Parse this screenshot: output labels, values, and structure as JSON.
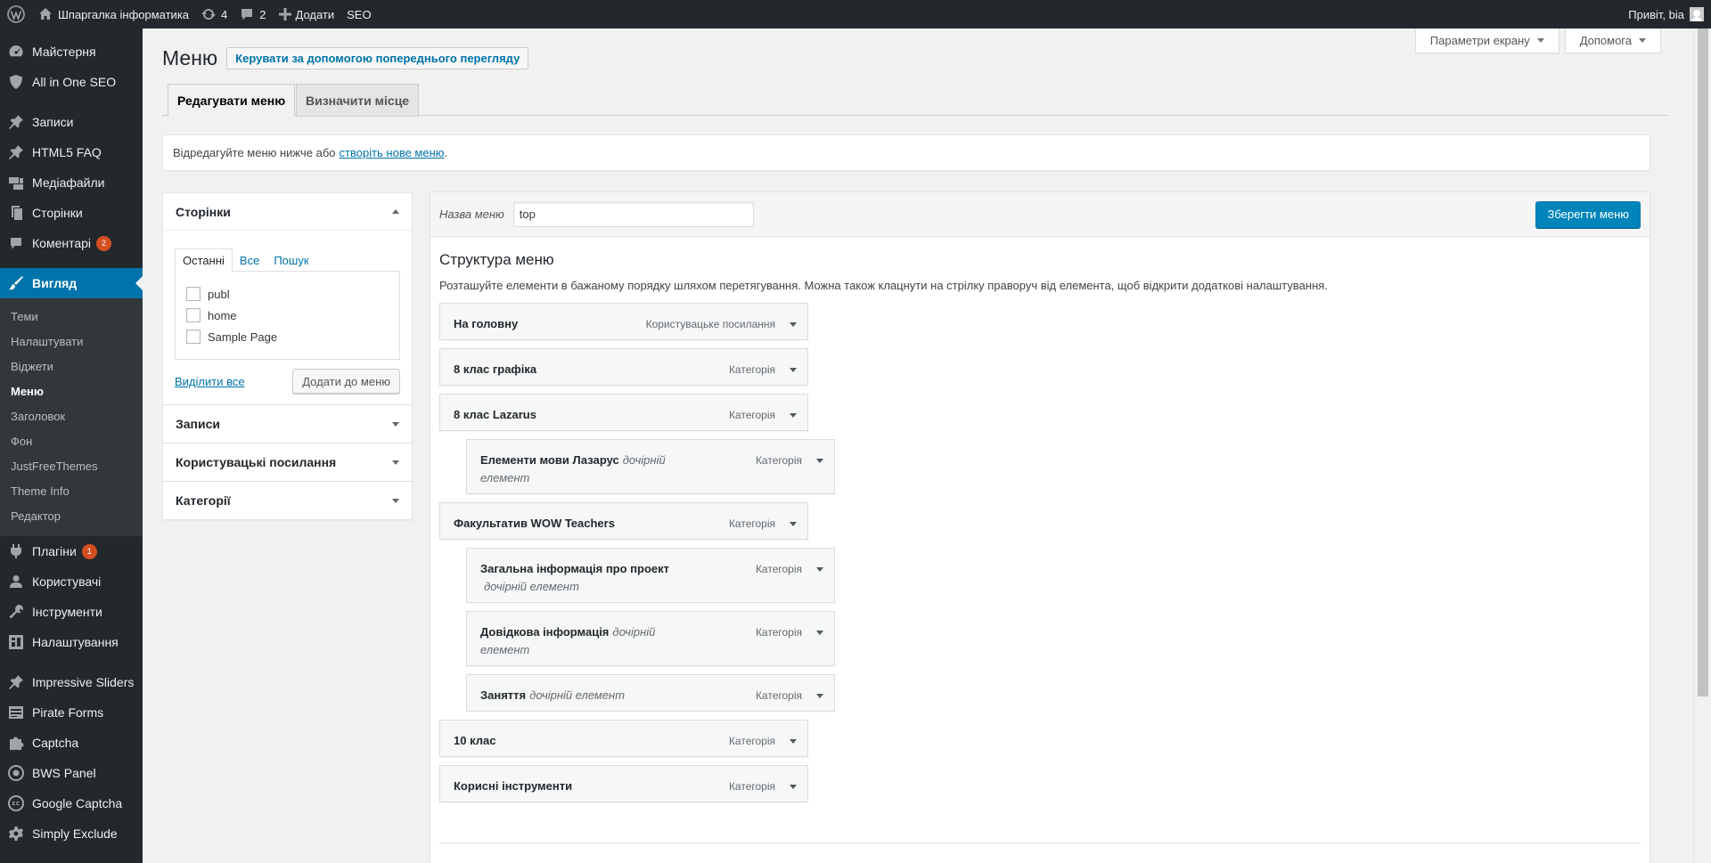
{
  "adminbar": {
    "site_name": "Шпаргалка інформатика",
    "updates_count": "4",
    "comments_count": "2",
    "new_label": "Додати",
    "seo_label": "SEO",
    "greeting": "Привіт, bia"
  },
  "sidebar": {
    "dashboard": "Майстерня",
    "aioseo": "All in One SEO",
    "posts": "Записи",
    "html5faq": "HTML5 FAQ",
    "media": "Медіафайли",
    "pages": "Сторінки",
    "comments": "Коментарі",
    "comments_badge": "2",
    "appearance": "Вигляд",
    "appearance_sub": [
      "Теми",
      "Налаштувати",
      "Віджети",
      "Меню",
      "Заголовок",
      "Фон",
      "JustFreeThemes",
      "Theme Info",
      "Редактор"
    ],
    "plugins": "Плагіни",
    "plugins_badge": "1",
    "users": "Користувачі",
    "tools": "Інструменти",
    "settings": "Налаштування",
    "impressive_sliders": "Impressive Sliders",
    "pirate_forms": "Pirate Forms",
    "captcha": "Captcha",
    "bws_panel": "BWS Panel",
    "google_captcha": "Google Captcha",
    "simply_exclude": "Simply Exclude"
  },
  "screen_options": {
    "screen_label": "Параметри екрану",
    "help_label": "Допомога"
  },
  "page": {
    "title": "Меню",
    "preview_action": "Керувати за допомогою попереднього перегляду",
    "tab_edit": "Редагувати меню",
    "tab_locations": "Визначити місце",
    "notice_text": "Відредагуйте меню нижче або ",
    "notice_link": "створіть нове меню",
    "notice_end": "."
  },
  "accordion": {
    "pages_title": "Сторінки",
    "tab_recent": "Останні",
    "tab_all": "Все",
    "tab_search": "Пошук",
    "pages": [
      "publ",
      "home",
      "Sample Page"
    ],
    "select_all": "Виділити все",
    "add_to_menu": "Додати до меню",
    "posts_title": "Записи",
    "custom_links_title": "Користувацькі посилання",
    "categories_title": "Категорії"
  },
  "menu_editor": {
    "name_label": "Назва меню",
    "name_value": "top",
    "save_label": "Зберегти меню",
    "structure_title": "Структура меню",
    "structure_desc": "Розташуйте елементи в бажаному порядку шляхом перетягування. Можна також клацнути на стрілку праворуч від елемента, щоб відкрити додаткові налаштування.",
    "sub_item_label": "дочірній елемент",
    "items": [
      {
        "title": "На головну",
        "type": "Користувацьке посилання"
      },
      {
        "title": "8 клас графіка",
        "type": "Категорія"
      },
      {
        "title": "8 клас Lazarus",
        "type": "Категорія"
      },
      {
        "title": "Елементи мови Лазарус",
        "type": "Категорія"
      },
      {
        "title": "Факультатив WOW Teachers",
        "type": "Категорія"
      },
      {
        "title": "Загальна інформація про проект",
        "type": "Категорія"
      },
      {
        "title": "Довідкова інформація",
        "type": "Категорія"
      },
      {
        "title": "Заняття",
        "type": "Категорія"
      },
      {
        "title": "10 клас",
        "type": "Категорія"
      },
      {
        "title": "Корисні інструменти",
        "type": "Категорія"
      }
    ]
  }
}
